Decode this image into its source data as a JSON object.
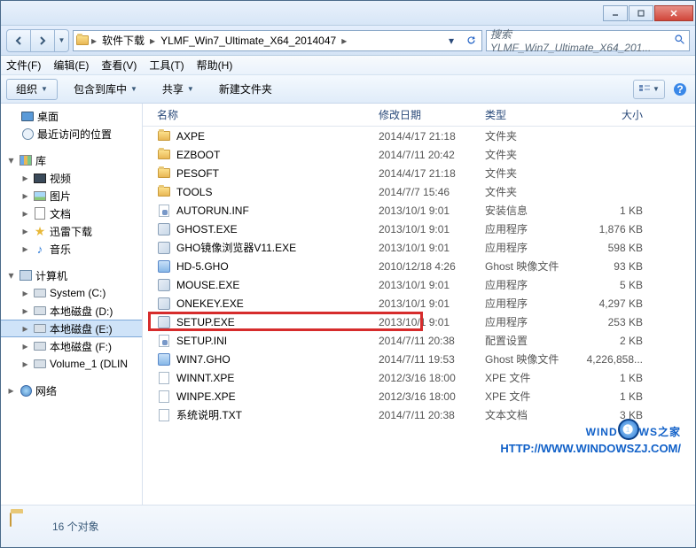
{
  "titlebar": {},
  "address": {
    "crumbs": [
      "软件下载",
      "YLMF_Win7_Ultimate_X64_2014047"
    ],
    "search_placeholder": "搜索 YLMF_Win7_Ultimate_X64_201..."
  },
  "menubar": [
    "文件(F)",
    "编辑(E)",
    "查看(V)",
    "工具(T)",
    "帮助(H)"
  ],
  "toolbar": {
    "organize": "组织",
    "include": "包含到库中",
    "share": "共享",
    "newfolder": "新建文件夹"
  },
  "sidebar": {
    "desktop": "桌面",
    "recent": "最近访问的位置",
    "libraries": "库",
    "videos": "视频",
    "pictures": "图片",
    "documents": "文档",
    "xunlei": "迅雷下载",
    "music": "音乐",
    "computer": "计算机",
    "drive_c": "System (C:)",
    "drive_d": "本地磁盘 (D:)",
    "drive_e": "本地磁盘 (E:)",
    "drive_f": "本地磁盘 (F:)",
    "drive_vol": "Volume_1 (DLIN",
    "network": "网络"
  },
  "columns": {
    "name": "名称",
    "date": "修改日期",
    "type": "类型",
    "size": "大小"
  },
  "files": [
    {
      "icon": "folder",
      "name": "AXPE",
      "date": "2014/4/17 21:18",
      "type": "文件夹",
      "size": ""
    },
    {
      "icon": "folder",
      "name": "EZBOOT",
      "date": "2014/7/11 20:42",
      "type": "文件夹",
      "size": ""
    },
    {
      "icon": "folder",
      "name": "PESOFT",
      "date": "2014/4/17 21:18",
      "type": "文件夹",
      "size": ""
    },
    {
      "icon": "folder",
      "name": "TOOLS",
      "date": "2014/7/7 15:46",
      "type": "文件夹",
      "size": ""
    },
    {
      "icon": "ini",
      "name": "AUTORUN.INF",
      "date": "2013/10/1 9:01",
      "type": "安装信息",
      "size": "1 KB"
    },
    {
      "icon": "exe",
      "name": "GHOST.EXE",
      "date": "2013/10/1 9:01",
      "type": "应用程序",
      "size": "1,876 KB"
    },
    {
      "icon": "exe",
      "name": "GHO镜像浏览器V11.EXE",
      "date": "2013/10/1 9:01",
      "type": "应用程序",
      "size": "598 KB"
    },
    {
      "icon": "gho",
      "name": "HD-5.GHO",
      "date": "2010/12/18 4:26",
      "type": "Ghost 映像文件",
      "size": "93 KB"
    },
    {
      "icon": "exe",
      "name": "MOUSE.EXE",
      "date": "2013/10/1 9:01",
      "type": "应用程序",
      "size": "5 KB"
    },
    {
      "icon": "exe",
      "name": "ONEKEY.EXE",
      "date": "2013/10/1 9:01",
      "type": "应用程序",
      "size": "4,297 KB"
    },
    {
      "icon": "exe",
      "name": "SETUP.EXE",
      "date": "2013/10/1 9:01",
      "type": "应用程序",
      "size": "253 KB"
    },
    {
      "icon": "ini",
      "name": "SETUP.INI",
      "date": "2014/7/11 20:38",
      "type": "配置设置",
      "size": "2 KB"
    },
    {
      "icon": "gho",
      "name": "WIN7.GHO",
      "date": "2014/7/11 19:53",
      "type": "Ghost 映像文件",
      "size": "4,226,858..."
    },
    {
      "icon": "file",
      "name": "WINNT.XPE",
      "date": "2012/3/16 18:00",
      "type": "XPE 文件",
      "size": "1 KB"
    },
    {
      "icon": "file",
      "name": "WINPE.XPE",
      "date": "2012/3/16 18:00",
      "type": "XPE 文件",
      "size": "1 KB"
    },
    {
      "icon": "txt",
      "name": "系统说明.TXT",
      "date": "2014/7/11 20:38",
      "type": "文本文档",
      "size": "3 KB"
    }
  ],
  "status": {
    "count_text": "16 个对象"
  },
  "watermark": {
    "line1_a": "WIND",
    "line1_b": "WS",
    "line1_c": "之家",
    "line2": "HTTP://WWW.WINDOWSZJ.COM/"
  }
}
